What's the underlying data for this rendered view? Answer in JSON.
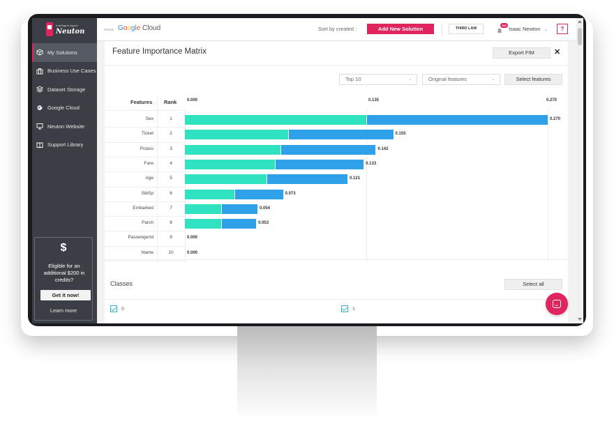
{
  "brand": {
    "tagline": "Intelligent Agent",
    "name": "Neuton"
  },
  "sidebar": {
    "items": [
      {
        "label": "My Solutions",
        "icon": "cube-icon",
        "active": true
      },
      {
        "label": "Business Use Cases",
        "icon": "briefcase-icon",
        "active": false
      },
      {
        "label": "Dataset Storage",
        "icon": "layers-icon",
        "active": false
      },
      {
        "label": "Google Cloud",
        "icon": "google-icon",
        "active": false
      },
      {
        "label": "Neuton Website",
        "icon": "monitor-icon",
        "active": false
      },
      {
        "label": "Support Library",
        "icon": "book-icon",
        "active": false
      }
    ],
    "promo": {
      "symbol": "$",
      "text": "Eligible for an additional $200 in credits?",
      "button": "Get it now!",
      "link": "Learn more"
    }
  },
  "topbar": {
    "partner": "Partner",
    "cloud_google": "Google",
    "cloud_word": "Cloud",
    "sort": "Sort by created",
    "sort_arrow": "↑",
    "new_button": "Add New Solution",
    "third_law": "THIRD LAW",
    "notifications": "104",
    "user": "Isaac Newton",
    "user_chevron": "⌄",
    "help": "?"
  },
  "panel": {
    "title": "Feature Importance Matrix",
    "export": "Export FIM",
    "close": "✕",
    "top_select": "Top 10",
    "features_select": "Original features",
    "select_button": "Select features"
  },
  "chart_data": {
    "type": "bar",
    "orientation": "horizontal",
    "stacked": true,
    "headers": {
      "features": "Features",
      "rank": "Rank"
    },
    "ticks": [
      "0.000",
      "0.135",
      "0.270"
    ],
    "xlim": [
      0,
      0.27
    ],
    "categories": [
      "Sex",
      "Ticket",
      "Pclass",
      "Fare",
      "Age",
      "SibSp",
      "Embarked",
      "Parch",
      "PassengerId",
      "Name"
    ],
    "ranks": [
      "1",
      "2",
      "3",
      "4",
      "5",
      "6",
      "7",
      "8",
      "9",
      "10"
    ],
    "totals": [
      0.27,
      0.155,
      0.142,
      0.133,
      0.121,
      0.073,
      0.054,
      0.053,
      0.0,
      0.0
    ],
    "total_labels": [
      "0.270",
      "0.155",
      "0.142",
      "0.133",
      "0.121",
      "0.073",
      "0.054",
      "0.053",
      "0.000",
      "0.000"
    ],
    "series": [
      {
        "color": "#2fe3c0",
        "values": [
          0.135,
          0.077,
          0.071,
          0.067,
          0.061,
          0.037,
          0.027,
          0.027,
          0,
          0
        ]
      },
      {
        "color": "#2ea1e8",
        "values": [
          0.135,
          0.078,
          0.071,
          0.066,
          0.06,
          0.036,
          0.027,
          0.026,
          0,
          0
        ]
      }
    ]
  },
  "classes": {
    "title": "Classes",
    "select_all": "Select all",
    "items": [
      "0",
      "1"
    ]
  },
  "colors": {
    "accent": "#e0245e",
    "sidebar": "#3b3e45",
    "teal": "#2fe3c0",
    "blue": "#2ea1e8"
  }
}
